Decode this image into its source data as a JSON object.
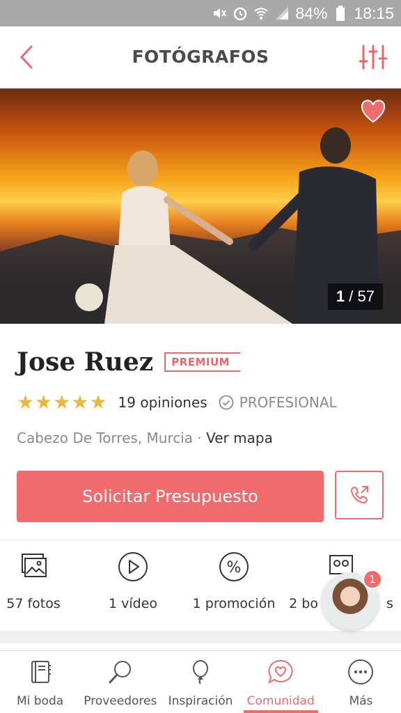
{
  "status_bar": {
    "battery": "84%",
    "time": "18:15",
    "icons": [
      "mute-icon",
      "alarm-icon",
      "wifi-icon",
      "signal-icon",
      "battery-icon"
    ]
  },
  "header": {
    "title": "FOTÓGRAFOS",
    "back_icon": "chevron-left-icon",
    "filter_icon": "sliders-icon"
  },
  "hero": {
    "counter_current": "1",
    "counter_sep": " / ",
    "counter_total": "57",
    "favorite_icon": "heart-icon"
  },
  "vendor": {
    "name": "Jose Ruez",
    "badge": "PREMIUM",
    "stars": 5,
    "opinions": "19 opiniones",
    "pro_label": "PROFESIONAL",
    "location": "Cabezo De Torres, Murcia",
    "location_sep": " · ",
    "map_link": "Ver mapa"
  },
  "actions": {
    "cta_label": "Solicitar Presupuesto",
    "call_icon": "phone-icon"
  },
  "stats": [
    {
      "label": "57 fotos",
      "icon": "photos-icon"
    },
    {
      "label": "1 vídeo",
      "icon": "play-icon"
    },
    {
      "label": "1 promoción",
      "icon": "percent-icon"
    },
    {
      "label": "2 bo",
      "label_end": "s",
      "icon": "album-icon"
    }
  ],
  "chat": {
    "badge_count": "1"
  },
  "bottom_nav": [
    {
      "label": "Mi boda",
      "icon": "notebook-icon",
      "active": false
    },
    {
      "label": "Proveedores",
      "icon": "search-icon",
      "active": false
    },
    {
      "label": "Inspiración",
      "icon": "balloon-icon",
      "active": false
    },
    {
      "label": "Comunidad",
      "icon": "chat-heart-icon",
      "active": true
    },
    {
      "label": "Más",
      "icon": "more-icon",
      "active": false
    }
  ],
  "colors": {
    "accent": "#ef6b6e",
    "star": "#e9b93b",
    "status_bar": "#a9a9a9"
  }
}
